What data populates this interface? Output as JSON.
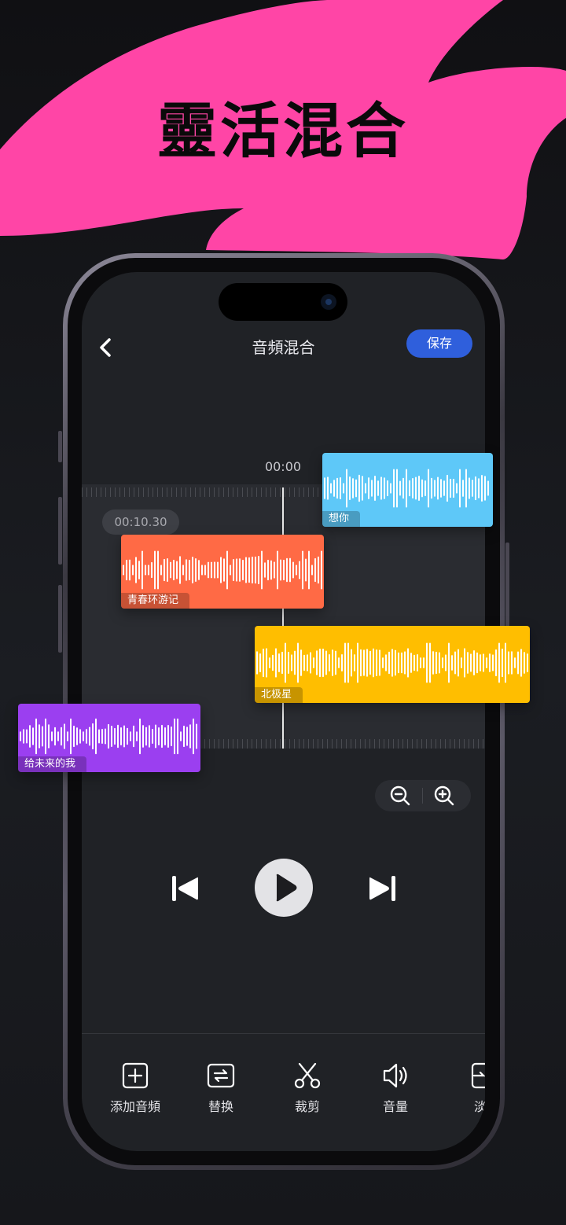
{
  "headline": "靈活混合",
  "header": {
    "back_icon": "chevron-left-icon",
    "title": "音頻混合",
    "save_label": "保存"
  },
  "timeline": {
    "current_time": "00:00",
    "pill_time": "00:10.30"
  },
  "clips": [
    {
      "label": "想你",
      "color": "#5ec8f8"
    },
    {
      "label": "青春环游记",
      "color": "#ff6a45"
    },
    {
      "label": "北极星",
      "color": "#ffbe00"
    },
    {
      "label": "给未来的我",
      "color": "#9b3ff0"
    }
  ],
  "zoom": {
    "out_icon": "zoom-out-icon",
    "in_icon": "zoom-in-icon"
  },
  "playback": {
    "prev_icon": "skip-previous-icon",
    "play_icon": "play-icon",
    "next_icon": "skip-next-icon"
  },
  "toolbar": [
    {
      "label": "添加音頻",
      "icon": "add-square-icon"
    },
    {
      "label": "替换",
      "icon": "replace-icon"
    },
    {
      "label": "裁剪",
      "icon": "scissors-icon"
    },
    {
      "label": "音量",
      "icon": "volume-icon"
    },
    {
      "label": "淡",
      "icon": "fade-icon"
    }
  ],
  "colors": {
    "accent": "#2f5fdc",
    "pink": "#ff45a6",
    "background": "#16171b"
  }
}
